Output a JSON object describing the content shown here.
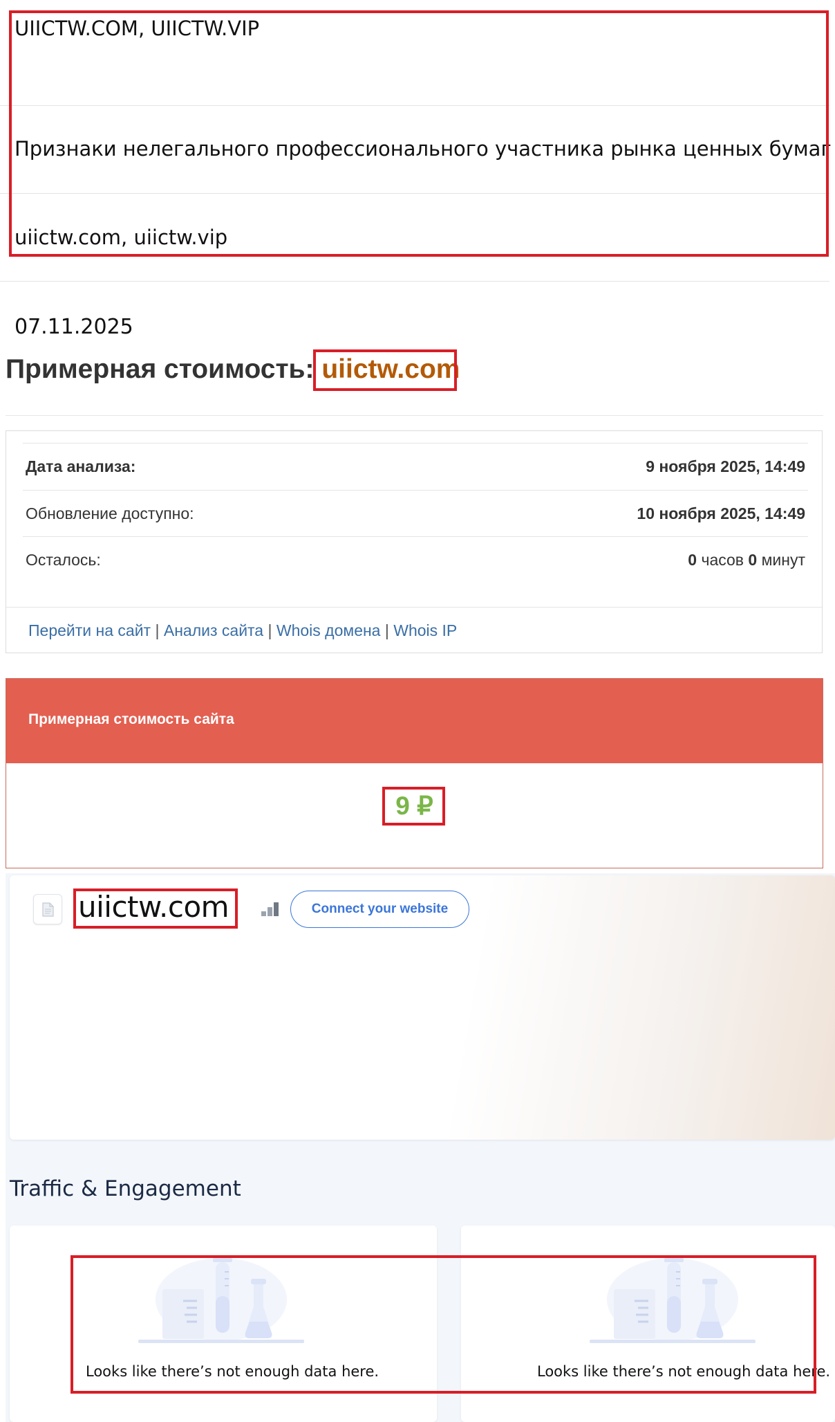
{
  "registry": {
    "site_names": "UIICTW.COM, UIICTW.VIP",
    "violation": "Признаки нелегального профессионального участника рынка ценных бумаг",
    "domains": "uiictw.com, uiictw.vip",
    "date": "07.11.2025"
  },
  "estimate": {
    "title_prefix": "Примерная стоимость:",
    "domain": "uiictw.com",
    "rows": [
      {
        "label": "Дата анализа:",
        "value": "9 ноября 2025, 14:49"
      },
      {
        "label": "Обновление доступно:",
        "value": "10 ноября 2025, 14:49"
      },
      {
        "label": "Осталось:",
        "hours": "0",
        "hours_unit": "часов",
        "minutes": "0",
        "minutes_unit": "минут"
      }
    ],
    "links": [
      "Перейти на сайт",
      "Анализ сайта",
      "Whois домена",
      "Whois IP"
    ],
    "link_separator": "|",
    "price_card_title": "Примерная стоимость сайта",
    "price_value": "9 ₽"
  },
  "similarweb": {
    "domain": "uiictw.com",
    "connect_button": "Connect your website",
    "section_title": "Traffic & Engagement",
    "no_data_left": "Looks like there’s not enough data here.",
    "no_data_right": "Looks like there’s not enough data here."
  },
  "colors": {
    "highlight_box": "#d81e27",
    "price_header": "#e35f50",
    "price_value": "#7ab648",
    "domain_accent": "#b35a07",
    "link": "#3a6ea5",
    "connect_button": "#3b76d9"
  },
  "icons": [
    "document-icon",
    "rank-bars-icon",
    "no-data-illustration"
  ]
}
